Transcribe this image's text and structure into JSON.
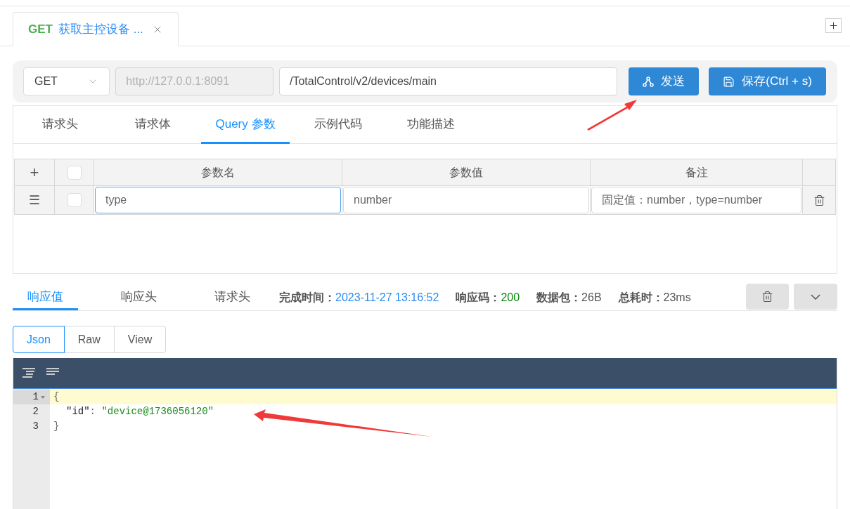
{
  "tabs": [
    {
      "method": "GET",
      "title": "获取主控设备 ...",
      "selected": true
    }
  ],
  "request": {
    "method": "GET",
    "base_url": "http://127.0.0.1:8091",
    "path": "/TotalControl/v2/devices/main",
    "send_label": "发送",
    "save_label": "保存(Ctrl + s)"
  },
  "param_tabs": [
    {
      "label": "请求头",
      "selected": false
    },
    {
      "label": "请求体",
      "selected": false
    },
    {
      "label": "Query 参数",
      "selected": true
    },
    {
      "label": "示例代码",
      "selected": false
    },
    {
      "label": "功能描述",
      "selected": false
    }
  ],
  "params_table": {
    "add_symbol": "+",
    "header_checked": false,
    "columns": [
      "参数名",
      "参数值",
      "备注"
    ],
    "rows": [
      {
        "handle": "☰",
        "checked": false,
        "name": "type",
        "name_focused": true,
        "value": "number",
        "note": "固定值：number，type=number"
      }
    ]
  },
  "response_tabs": [
    {
      "label": "响应值",
      "selected": true
    },
    {
      "label": "响应头",
      "selected": false
    },
    {
      "label": "请求头",
      "selected": false
    }
  ],
  "response_stats": [
    {
      "label": "完成时间：",
      "value": "2023-11-27 13:16:52",
      "kind": "time"
    },
    {
      "label": "响应码：",
      "value": "200",
      "kind": "status"
    },
    {
      "label": "数据包：",
      "value": "26B",
      "kind": "plain"
    },
    {
      "label": "总耗时：",
      "value": "23ms",
      "kind": "plain"
    }
  ],
  "view_modes": [
    {
      "label": "Json",
      "selected": true
    },
    {
      "label": "Raw",
      "selected": false
    },
    {
      "label": "View",
      "selected": false
    }
  ],
  "editor": {
    "lines": [
      {
        "number": "1",
        "highlighted": true,
        "foldable": true,
        "indent": false,
        "segments": [
          {
            "text": "{",
            "kind": "punct"
          }
        ]
      },
      {
        "number": "2",
        "highlighted": false,
        "foldable": false,
        "indent": true,
        "segments": [
          {
            "text": "\"id\"",
            "kind": "key"
          },
          {
            "text": ": ",
            "kind": "punct"
          },
          {
            "text": "\"device@1736056120\"",
            "kind": "string"
          }
        ]
      },
      {
        "number": "3",
        "highlighted": false,
        "foldable": false,
        "indent": false,
        "segments": [
          {
            "text": "}",
            "kind": "punct"
          }
        ]
      }
    ]
  }
}
